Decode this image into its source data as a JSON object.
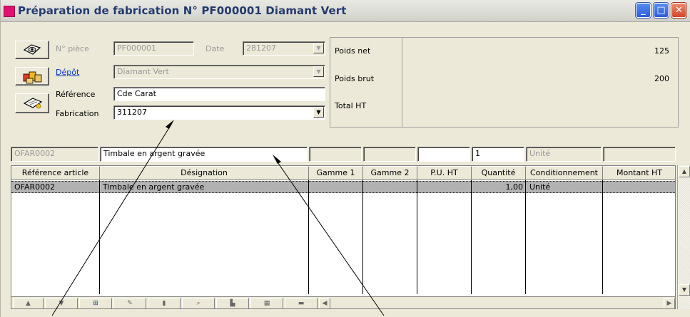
{
  "window": {
    "title": "Préparation de fabrication N° PF000001 Diamant Vert",
    "buttons": {
      "minimize": "_",
      "maximize": "□",
      "close": "✕"
    }
  },
  "header": {
    "piece_label": "N° pièce",
    "piece_value": "PF000001",
    "date_label": "Date",
    "date_value": "281207",
    "depot_label": "Dépôt",
    "depot_value": "Diamant Vert",
    "reference_label": "Référence",
    "reference_value": "Cde Carat",
    "fabrication_label": "Fabrication",
    "fabrication_value": "311207"
  },
  "info_panel": {
    "poids_net_label": "Poids net",
    "poids_net_value": "125",
    "poids_brut_label": "Poids brut",
    "poids_brut_value": "200",
    "total_ht_label": "Total HT",
    "total_ht_value": ""
  },
  "entry_line": {
    "reference": "OFAR0002",
    "designation": "Timbale en argent gravée",
    "gamme1": "",
    "gamme2": "",
    "pu_ht": "",
    "quantite": "1",
    "conditionnement": "Unité",
    "montant_ht": ""
  },
  "table": {
    "columns": [
      "Référence article",
      "Désignation",
      "Gamme 1",
      "Gamme 2",
      "P.U. HT",
      "Quantité",
      "Conditionnement",
      "Montant HT"
    ],
    "rows": [
      {
        "reference": "OFAR0002",
        "designation": "Timbale en argent gravée",
        "gamme1": "",
        "gamme2": "",
        "pu_ht": "",
        "quantite": "1,00",
        "conditionnement": "Unité",
        "montant_ht": ""
      }
    ]
  },
  "icons": {
    "app": "app-icon",
    "piece_button": "eye-icon",
    "depot_button": "boxes-icon",
    "reference_button": "document-icon"
  },
  "colors": {
    "title_text": "#233a6e",
    "app_icon": "#e0106e",
    "link": "#0033cc",
    "selected_row": "#b2b2b2"
  }
}
